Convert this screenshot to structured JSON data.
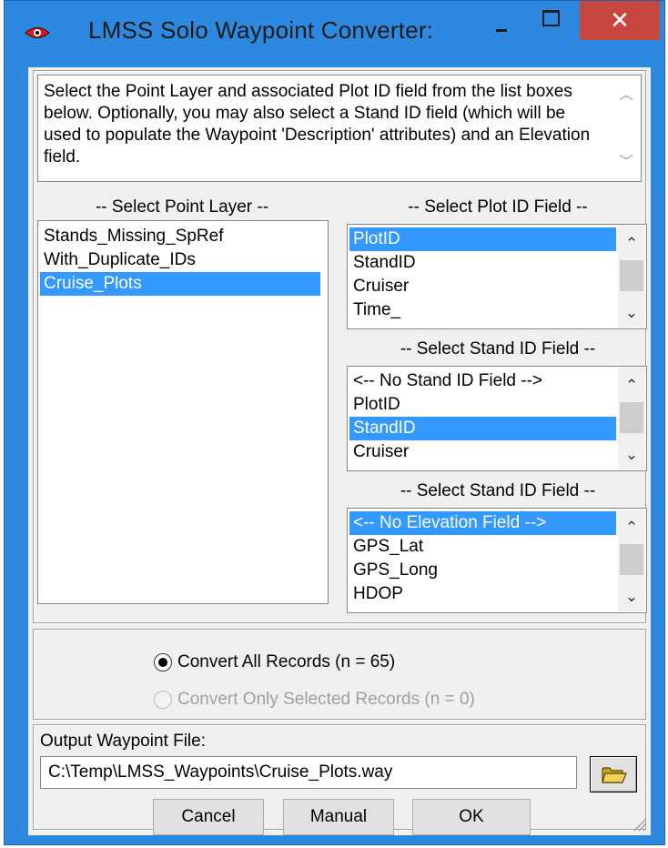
{
  "window": {
    "title": "LMSS Solo Waypoint Converter:",
    "close_glyph": "✕",
    "accent_color": "#2d89e0",
    "close_color": "#c7463d"
  },
  "description": "Select the Point Layer and associated Plot ID field from the list boxes below.  Optionally, you may also select a Stand ID field (which will be used to populate the Waypoint 'Description' attributes) and an Elevation field.",
  "point_layer": {
    "label": "-- Select Point Layer --",
    "items": [
      "Stands_Missing_SpRef",
      "With_Duplicate_IDs",
      "Cruise_Plots"
    ],
    "selected_index": 2
  },
  "plot_id": {
    "label": "-- Select Plot ID Field --",
    "items": [
      "PlotID",
      "StandID",
      "Cruiser",
      "Time_"
    ],
    "selected_index": 0
  },
  "stand_id": {
    "label": "-- Select Stand ID Field --",
    "items": [
      "<-- No Stand ID Field -->",
      "PlotID",
      "StandID",
      "Cruiser"
    ],
    "selected_index": 2
  },
  "elevation": {
    "label": "-- Select Stand ID Field --",
    "items": [
      "<-- No Elevation Field -->",
      "GPS_Lat",
      "GPS_Long",
      "HDOP"
    ],
    "selected_index": 0
  },
  "convert": {
    "all_label": "Convert All Records (n = 65)",
    "selected_label": "Convert Only Selected Records (n = 0)",
    "checked": "all"
  },
  "output": {
    "label": "Output Waypoint File:",
    "value": "C:\\Temp\\LMSS_Waypoints\\Cruise_Plots.way"
  },
  "buttons": {
    "cancel": "Cancel",
    "manual": "Manual",
    "ok": "OK"
  }
}
